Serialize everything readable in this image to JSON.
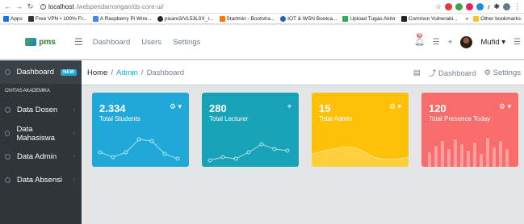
{
  "browser": {
    "url_host": "localhost",
    "url_path": "/webpendamongan/ds-core-ui/",
    "bookmarks": [
      "Apps",
      "Free VPN • 100% Fr...",
      "A Raspberry Pi Wire...",
      "pixaro3/VL53L0X_r...",
      "Startmin - Bootstra...",
      "IOT & WSN Bootca...",
      "Upload Tugas Akhir",
      "Common Vulnerabi..."
    ],
    "bookmarks_more": "»",
    "other_bookmarks": "Other bookmarks"
  },
  "header": {
    "brand": "pms",
    "nav": [
      "Dashboard",
      "Users",
      "Settings"
    ],
    "notif_count": "5",
    "user_name": "Mufid"
  },
  "sidebar": {
    "dashboard": "Dashboard",
    "new_badge": "NEW",
    "section_title": "CIVITAS AKADEMIKA",
    "items": [
      "Data Dosen",
      "Data Mahasiswa",
      "Data Admin",
      "Data Absensi"
    ]
  },
  "breadcrumb": {
    "home": "Home",
    "admin": "Admin",
    "current": "Dashboard",
    "right_dashboard": "Dashboard",
    "right_settings": "Settings"
  },
  "cards": [
    {
      "value": "2.334",
      "label": "Total Students",
      "color": "#20a8d8"
    },
    {
      "value": "280",
      "label": "Total Lecturer",
      "color": "#17a2b8"
    },
    {
      "value": "15",
      "label": "Total Admin",
      "color": "#ffc107"
    },
    {
      "value": "120",
      "label": "Total Presence Today",
      "color": "#f86c6b"
    }
  ]
}
